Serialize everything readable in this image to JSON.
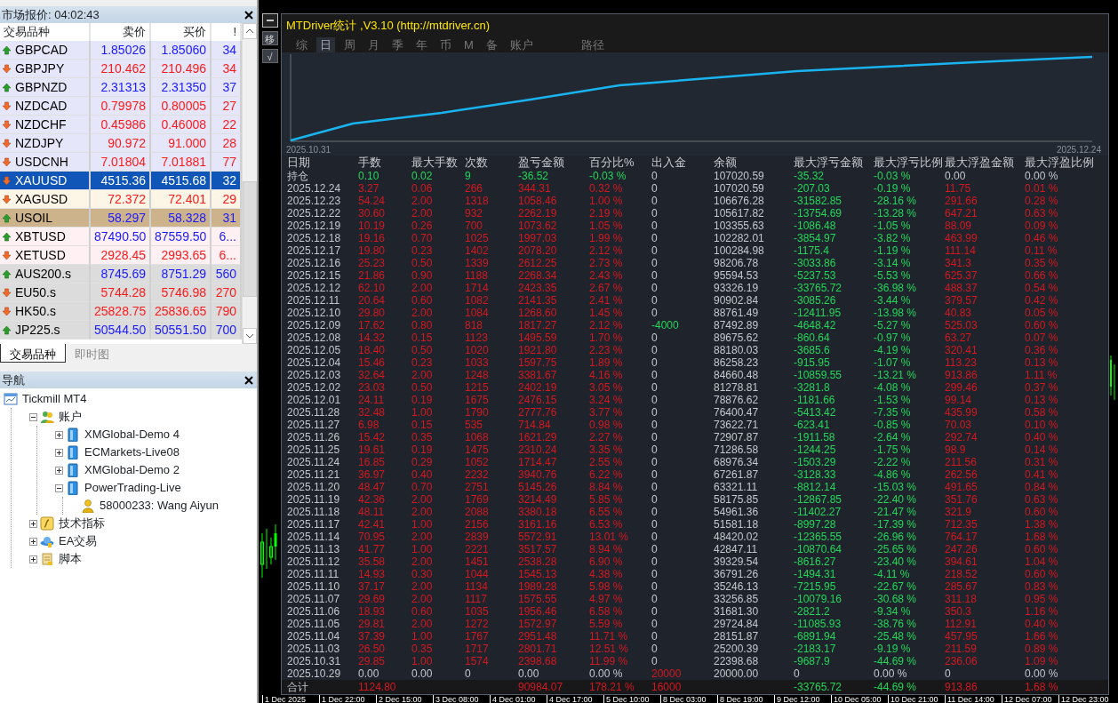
{
  "market_watch": {
    "title": "市场报价: 04:02:43",
    "columns": [
      "交易品种",
      "卖价",
      "买价",
      "!"
    ],
    "rows": [
      {
        "symbol": "GBPCAD",
        "bid": "1.85026",
        "ask": "1.85060",
        "spread": "34",
        "rising": true,
        "color": "#e6e6fa",
        "selected": false
      },
      {
        "symbol": "GBPJPY",
        "bid": "210.462",
        "ask": "210.496",
        "spread": "34",
        "rising": false,
        "color": "#e6e6fa",
        "selected": false
      },
      {
        "symbol": "GBPNZD",
        "bid": "2.31313",
        "ask": "2.31350",
        "spread": "37",
        "rising": true,
        "color": "#e6e6fa",
        "selected": false
      },
      {
        "symbol": "NZDCAD",
        "bid": "0.79978",
        "ask": "0.80005",
        "spread": "27",
        "rising": false,
        "color": "#e6e6fa",
        "selected": false
      },
      {
        "symbol": "NZDCHF",
        "bid": "0.45986",
        "ask": "0.46008",
        "spread": "22",
        "rising": false,
        "color": "#e6e6fa",
        "selected": false
      },
      {
        "symbol": "NZDJPY",
        "bid": "90.972",
        "ask": "91.000",
        "spread": "28",
        "rising": false,
        "color": "#e6e6fa",
        "selected": false
      },
      {
        "symbol": "USDCNH",
        "bid": "7.01804",
        "ask": "7.01881",
        "spread": "77",
        "rising": false,
        "color": "#e6e6fa",
        "selected": false
      },
      {
        "symbol": "XAUUSD",
        "bid": "4515.36",
        "ask": "4515.68",
        "spread": "32",
        "rising": false,
        "selected": true
      },
      {
        "symbol": "XAGUSD",
        "bid": "72.372",
        "ask": "72.401",
        "spread": "29",
        "rising": false,
        "color": "#fdf5e6",
        "selected": false
      },
      {
        "symbol": "USOIL",
        "bid": "58.297",
        "ask": "58.328",
        "spread": "31",
        "rising": true,
        "color": "#cdb38c",
        "selected": false
      },
      {
        "symbol": "XBTUSD",
        "bid": "87490.50",
        "ask": "87559.50",
        "spread": "6...",
        "rising": true,
        "color": "#fff0f3",
        "selected": false
      },
      {
        "symbol": "XETUSD",
        "bid": "2928.45",
        "ask": "2993.65",
        "spread": "6...",
        "rising": false,
        "color": "#fff0f3",
        "selected": false
      },
      {
        "symbol": "AUS200.s",
        "bid": "8745.69",
        "ask": "8751.29",
        "spread": "560",
        "rising": true,
        "color": "#dcdcdc",
        "selected": false
      },
      {
        "symbol": "EU50.s",
        "bid": "5744.28",
        "ask": "5746.98",
        "spread": "270",
        "rising": false,
        "color": "#dcdcdc",
        "selected": false
      },
      {
        "symbol": "HK50.s",
        "bid": "25828.75",
        "ask": "25836.65",
        "spread": "790",
        "rising": false,
        "color": "#dcdcdc",
        "selected": false
      },
      {
        "symbol": "JP225.s",
        "bid": "50544.50",
        "ask": "50551.50",
        "spread": "700",
        "rising": true,
        "color": "#dcdcdc",
        "selected": false
      }
    ],
    "tabs": [
      {
        "label": "交易品种",
        "selected": true
      },
      {
        "label": "即时图",
        "selected": false
      }
    ]
  },
  "navigator": {
    "title": "导航",
    "tree": [
      {
        "label": "Tickmill MT4",
        "kind": "terminal",
        "children": [
          {
            "label": "账户",
            "kind": "accounts",
            "expanded": true,
            "children": [
              {
                "label": "XMGlobal-Demo 4",
                "kind": "server",
                "expanded": false
              },
              {
                "label": "ECMarkets-Live08",
                "kind": "server",
                "expanded": false
              },
              {
                "label": "XMGlobal-Demo 2",
                "kind": "server",
                "expanded": false
              },
              {
                "label": "PowerTrading-Live",
                "kind": "server",
                "expanded": true,
                "children": [
                  {
                    "label": "58000233: Wang Aiyun",
                    "kind": "account"
                  }
                ]
              }
            ]
          },
          {
            "label": "技术指标",
            "kind": "indicators",
            "expanded": false
          },
          {
            "label": "EA交易",
            "kind": "experts",
            "expanded": false
          },
          {
            "label": "脚本",
            "kind": "scripts",
            "expanded": false
          }
        ]
      }
    ]
  },
  "side_buttons": [
    {
      "label": "移"
    },
    {
      "label": "√"
    }
  ],
  "stats_panel": {
    "title": "MTDriver统计 ,V3.10 (http://mtdriver.cn)",
    "tabs": [
      {
        "label": "综",
        "selected": false
      },
      {
        "label": "日",
        "selected": true
      },
      {
        "label": "周",
        "selected": false
      },
      {
        "label": "月",
        "selected": false
      },
      {
        "label": "季",
        "selected": false
      },
      {
        "label": "年",
        "selected": false
      },
      {
        "label": "币",
        "selected": false
      },
      {
        "label": "M",
        "selected": false
      },
      {
        "label": "备",
        "selected": false
      },
      {
        "label": "账户",
        "selected": false
      },
      {
        "label": "路径",
        "selected": false
      }
    ],
    "chart": {
      "start_label": "2025.10.31",
      "end_label": "2025.12.24"
    },
    "table": {
      "columns": [
        "日期",
        "手数",
        "最大手数",
        "次数",
        "盈亏金额",
        "百分比%",
        "出入金",
        "余额",
        "最大浮亏金额",
        "最大浮亏比例",
        "最大浮盈金额",
        "最大浮盈比例"
      ],
      "rows": [
        {
          "kind": "position",
          "deposit": false,
          "withdrawal": false,
          "cells": [
            "持仓",
            "0.10",
            "0.02",
            "9",
            "-36.52",
            "-0.03 %",
            "0",
            "107020.59",
            "-35.32",
            "-0.03 %",
            "0.00",
            "0.00 %"
          ]
        },
        {
          "kind": "day",
          "deposit": false,
          "withdrawal": false,
          "cells": [
            "2025.12.24",
            "3.27",
            "0.06",
            "266",
            "344.31",
            "0.32 %",
            "0",
            "107020.59",
            "-207.03",
            "-0.19 %",
            "11.75",
            "0.01 %"
          ]
        },
        {
          "kind": "day",
          "deposit": false,
          "withdrawal": false,
          "cells": [
            "2025.12.23",
            "54.24",
            "2.00",
            "1318",
            "1058.46",
            "1.00 %",
            "0",
            "106676.28",
            "-31582.85",
            "-28.16 %",
            "291.66",
            "0.28 %"
          ]
        },
        {
          "kind": "day",
          "deposit": false,
          "withdrawal": false,
          "cells": [
            "2025.12.22",
            "30.60",
            "2.00",
            "932",
            "2262.19",
            "2.19 %",
            "0",
            "105617.82",
            "-13754.69",
            "-13.28 %",
            "647.21",
            "0.63 %"
          ]
        },
        {
          "kind": "day",
          "deposit": false,
          "withdrawal": false,
          "cells": [
            "2025.12.19",
            "10.19",
            "0.26",
            "700",
            "1073.62",
            "1.05 %",
            "0",
            "103355.63",
            "-1086.48",
            "-1.05 %",
            "88.09",
            "0.09 %"
          ]
        },
        {
          "kind": "day",
          "deposit": false,
          "withdrawal": false,
          "cells": [
            "2025.12.18",
            "19.16",
            "0.70",
            "1025",
            "1997.03",
            "1.99 %",
            "0",
            "102282.01",
            "-3854.97",
            "-3.82 %",
            "463.99",
            "0.46 %"
          ]
        },
        {
          "kind": "day",
          "deposit": false,
          "withdrawal": false,
          "cells": [
            "2025.12.17",
            "19.80",
            "0.23",
            "1402",
            "2078.20",
            "2.12 %",
            "0",
            "100284.98",
            "-1175.4",
            "-1.19 %",
            "111.14",
            "0.11 %"
          ]
        },
        {
          "kind": "day",
          "deposit": false,
          "withdrawal": false,
          "cells": [
            "2025.12.16",
            "25.23",
            "0.50",
            "1339",
            "2612.25",
            "2.73 %",
            "0",
            "98206.78",
            "-3033.86",
            "-3.14 %",
            "341.3",
            "0.35 %"
          ]
        },
        {
          "kind": "day",
          "deposit": false,
          "withdrawal": false,
          "cells": [
            "2025.12.15",
            "21.86",
            "0.90",
            "1188",
            "2268.34",
            "2.43 %",
            "0",
            "95594.53",
            "-5237.53",
            "-5.53 %",
            "625.37",
            "0.66 %"
          ]
        },
        {
          "kind": "day",
          "deposit": false,
          "withdrawal": false,
          "cells": [
            "2025.12.12",
            "62.10",
            "2.00",
            "1714",
            "2423.35",
            "2.67 %",
            "0",
            "93326.19",
            "-33765.72",
            "-36.98 %",
            "488.37",
            "0.54 %"
          ]
        },
        {
          "kind": "day",
          "deposit": false,
          "withdrawal": false,
          "cells": [
            "2025.12.11",
            "20.64",
            "0.60",
            "1082",
            "2141.35",
            "2.41 %",
            "0",
            "90902.84",
            "-3085.26",
            "-3.44 %",
            "379.57",
            "0.42 %"
          ]
        },
        {
          "kind": "day",
          "deposit": false,
          "withdrawal": false,
          "cells": [
            "2025.12.10",
            "29.80",
            "2.00",
            "1084",
            "1268.60",
            "1.45 %",
            "0",
            "88761.49",
            "-12411.95",
            "-13.98 %",
            "40.83",
            "0.05 %"
          ]
        },
        {
          "kind": "day",
          "deposit": false,
          "withdrawal": true,
          "cells": [
            "2025.12.09",
            "17.62",
            "0.80",
            "818",
            "1817.27",
            "2.12 %",
            "-4000",
            "87492.89",
            "-4648.42",
            "-5.27 %",
            "525.03",
            "0.60 %"
          ]
        },
        {
          "kind": "day",
          "deposit": false,
          "withdrawal": false,
          "cells": [
            "2025.12.08",
            "14.32",
            "0.15",
            "1123",
            "1495.59",
            "1.70 %",
            "0",
            "89675.62",
            "-860.64",
            "-0.97 %",
            "63.27",
            "0.07 %"
          ]
        },
        {
          "kind": "day",
          "deposit": false,
          "withdrawal": false,
          "cells": [
            "2025.12.05",
            "18.40",
            "0.50",
            "1020",
            "1921.80",
            "2.23 %",
            "0",
            "88180.03",
            "-3685.6",
            "-4.19 %",
            "320.41",
            "0.36 %"
          ]
        },
        {
          "kind": "day",
          "deposit": false,
          "withdrawal": false,
          "cells": [
            "2025.12.04",
            "15.46",
            "0.23",
            "1033",
            "1597.75",
            "1.89 %",
            "0",
            "86258.23",
            "-915.95",
            "-1.07 %",
            "113.23",
            "0.13 %"
          ]
        },
        {
          "kind": "day",
          "deposit": false,
          "withdrawal": false,
          "cells": [
            "2025.12.03",
            "32.64",
            "2.00",
            "1248",
            "3381.67",
            "4.16 %",
            "0",
            "84660.48",
            "-10859.55",
            "-13.21 %",
            "913.86",
            "1.11 %"
          ]
        },
        {
          "kind": "day",
          "deposit": false,
          "withdrawal": false,
          "cells": [
            "2025.12.02",
            "23.03",
            "0.50",
            "1215",
            "2402.19",
            "3.05 %",
            "0",
            "81278.81",
            "-3281.8",
            "-4.08 %",
            "299.46",
            "0.37 %"
          ]
        },
        {
          "kind": "day",
          "deposit": false,
          "withdrawal": false,
          "cells": [
            "2025.12.01",
            "24.11",
            "0.19",
            "1675",
            "2476.15",
            "3.24 %",
            "0",
            "78876.62",
            "-1181.66",
            "-1.53 %",
            "99.14",
            "0.13 %"
          ]
        },
        {
          "kind": "day",
          "deposit": false,
          "withdrawal": false,
          "cells": [
            "2025.11.28",
            "32.48",
            "1.00",
            "1790",
            "2777.76",
            "3.77 %",
            "0",
            "76400.47",
            "-5413.42",
            "-7.35 %",
            "435.99",
            "0.58 %"
          ]
        },
        {
          "kind": "day",
          "deposit": false,
          "withdrawal": false,
          "cells": [
            "2025.11.27",
            "6.98",
            "0.15",
            "535",
            "714.84",
            "0.98 %",
            "0",
            "73622.71",
            "-623.41",
            "-0.85 %",
            "70.03",
            "0.10 %"
          ]
        },
        {
          "kind": "day",
          "deposit": false,
          "withdrawal": false,
          "cells": [
            "2025.11.26",
            "15.42",
            "0.35",
            "1068",
            "1621.29",
            "2.27 %",
            "0",
            "72907.87",
            "-1911.58",
            "-2.64 %",
            "292.74",
            "0.40 %"
          ]
        },
        {
          "kind": "day",
          "deposit": false,
          "withdrawal": false,
          "cells": [
            "2025.11.25",
            "19.61",
            "0.19",
            "1475",
            "2310.24",
            "3.35 %",
            "0",
            "71286.58",
            "-1244.25",
            "-1.75 %",
            "98.9",
            "0.14 %"
          ]
        },
        {
          "kind": "day",
          "deposit": false,
          "withdrawal": false,
          "cells": [
            "2025.11.24",
            "16.85",
            "0.29",
            "1052",
            "1714.47",
            "2.55 %",
            "0",
            "68976.34",
            "-1503.29",
            "-2.22 %",
            "211.56",
            "0.31 %"
          ]
        },
        {
          "kind": "day",
          "deposit": false,
          "withdrawal": false,
          "cells": [
            "2025.11.21",
            "36.97",
            "0.40",
            "2232",
            "3940.76",
            "6.22 %",
            "0",
            "67261.87",
            "-3128.33",
            "-4.86 %",
            "262.56",
            "0.41 %"
          ]
        },
        {
          "kind": "day",
          "deposit": false,
          "withdrawal": false,
          "cells": [
            "2025.11.20",
            "48.47",
            "0.70",
            "2751",
            "5145.26",
            "8.84 %",
            "0",
            "63321.11",
            "-8812.14",
            "-15.03 %",
            "491.65",
            "0.84 %"
          ]
        },
        {
          "kind": "day",
          "deposit": false,
          "withdrawal": false,
          "cells": [
            "2025.11.19",
            "42.36",
            "2.00",
            "1769",
            "3214.49",
            "5.85 %",
            "0",
            "58175.85",
            "-12867.85",
            "-22.40 %",
            "351.76",
            "0.63 %"
          ]
        },
        {
          "kind": "day",
          "deposit": false,
          "withdrawal": false,
          "cells": [
            "2025.11.18",
            "48.11",
            "2.00",
            "2088",
            "3380.18",
            "6.55 %",
            "0",
            "54961.36",
            "-11402.27",
            "-21.47 %",
            "321.9",
            "0.60 %"
          ]
        },
        {
          "kind": "day",
          "deposit": false,
          "withdrawal": false,
          "cells": [
            "2025.11.17",
            "42.41",
            "1.00",
            "2156",
            "3161.16",
            "6.53 %",
            "0",
            "51581.18",
            "-8997.28",
            "-17.39 %",
            "712.35",
            "1.38 %"
          ]
        },
        {
          "kind": "day",
          "deposit": false,
          "withdrawal": false,
          "cells": [
            "2025.11.14",
            "70.95",
            "2.00",
            "2839",
            "5572.91",
            "13.01 %",
            "0",
            "48420.02",
            "-12365.55",
            "-26.96 %",
            "764.17",
            "1.68 %"
          ]
        },
        {
          "kind": "day",
          "deposit": false,
          "withdrawal": false,
          "cells": [
            "2025.11.13",
            "41.77",
            "1.00",
            "2221",
            "3517.57",
            "8.94 %",
            "0",
            "42847.11",
            "-10870.64",
            "-25.65 %",
            "247.26",
            "0.60 %"
          ]
        },
        {
          "kind": "day",
          "deposit": false,
          "withdrawal": false,
          "cells": [
            "2025.11.12",
            "35.58",
            "2.00",
            "1451",
            "2538.28",
            "6.90 %",
            "0",
            "39329.54",
            "-8616.27",
            "-23.40 %",
            "394.61",
            "1.04 %"
          ]
        },
        {
          "kind": "day",
          "deposit": false,
          "withdrawal": false,
          "cells": [
            "2025.11.11",
            "14.93",
            "0.30",
            "1044",
            "1545.13",
            "4.38 %",
            "0",
            "36791.26",
            "-1494.31",
            "-4.11 %",
            "218.52",
            "0.60 %"
          ]
        },
        {
          "kind": "day",
          "deposit": false,
          "withdrawal": false,
          "cells": [
            "2025.11.10",
            "37.17",
            "2.00",
            "1134",
            "1989.28",
            "5.98 %",
            "0",
            "35246.13",
            "-7215.95",
            "-22.67 %",
            "285.67",
            "0.83 %"
          ]
        },
        {
          "kind": "day",
          "deposit": false,
          "withdrawal": false,
          "cells": [
            "2025.11.07",
            "29.69",
            "2.00",
            "1117",
            "1575.55",
            "4.97 %",
            "0",
            "33256.85",
            "-10079.16",
            "-30.68 %",
            "311.18",
            "0.95 %"
          ]
        },
        {
          "kind": "day",
          "deposit": false,
          "withdrawal": false,
          "cells": [
            "2025.11.06",
            "18.93",
            "0.60",
            "1035",
            "1956.46",
            "6.58 %",
            "0",
            "31681.30",
            "-2821.2",
            "-9.34 %",
            "350.3",
            "1.16 %"
          ]
        },
        {
          "kind": "day",
          "deposit": false,
          "withdrawal": false,
          "cells": [
            "2025.11.05",
            "29.81",
            "2.00",
            "1272",
            "1572.97",
            "5.59 %",
            "0",
            "29724.84",
            "-11085.93",
            "-38.76 %",
            "112.91",
            "0.40 %"
          ]
        },
        {
          "kind": "day",
          "deposit": false,
          "withdrawal": false,
          "cells": [
            "2025.11.04",
            "37.39",
            "1.00",
            "1767",
            "2951.48",
            "11.71 %",
            "0",
            "28151.87",
            "-6891.94",
            "-25.48 %",
            "457.95",
            "1.66 %"
          ]
        },
        {
          "kind": "day",
          "deposit": false,
          "withdrawal": false,
          "cells": [
            "2025.11.03",
            "26.50",
            "0.35",
            "1717",
            "2801.71",
            "12.51 %",
            "0",
            "25200.39",
            "-2183.17",
            "-9.19 %",
            "211.59",
            "0.89 %"
          ]
        },
        {
          "kind": "day",
          "deposit": false,
          "withdrawal": false,
          "cells": [
            "2025.10.31",
            "29.85",
            "1.00",
            "1574",
            "2398.68",
            "11.99 %",
            "0",
            "22398.68",
            "-9687.9",
            "-44.69 %",
            "236.06",
            "1.09 %"
          ]
        },
        {
          "kind": "opening",
          "deposit": true,
          "withdrawal": false,
          "cells": [
            "2025.10.29",
            "0.00",
            "0.00",
            "0",
            "0.00",
            "0.00 %",
            "20000",
            "20000.00",
            "0",
            "0.00 %",
            "0",
            "0.00 %"
          ]
        }
      ],
      "total": {
        "label": "合计",
        "lots": "1124.80",
        "pnl": "90984.07",
        "pct": "178.21 %",
        "flow_amount": "16000",
        "deposit": true,
        "withdrawal": false,
        "max_float_loss": "-33765.72",
        "max_float_loss_pct": "-44.69 %",
        "max_float_profit": "913.86",
        "max_float_profit_pct": "1.68 %"
      }
    }
  },
  "time_axis": [
    "1 Dec 2025",
    "1 Dec 22:00",
    "2 Dec 15:00",
    "3 Dec 08:00",
    "4 Dec 01:00",
    "4 Dec 17:00",
    "5 Dec 10:00",
    "8 Dec 03:00",
    "8 Dec 19:00",
    "9 Dec 12:00",
    "10 Dec 05:00",
    "10 Dec 21:00",
    "11 Dec 14:00",
    "12 Dec 07:00",
    "12 Dec 23:00"
  ]
}
